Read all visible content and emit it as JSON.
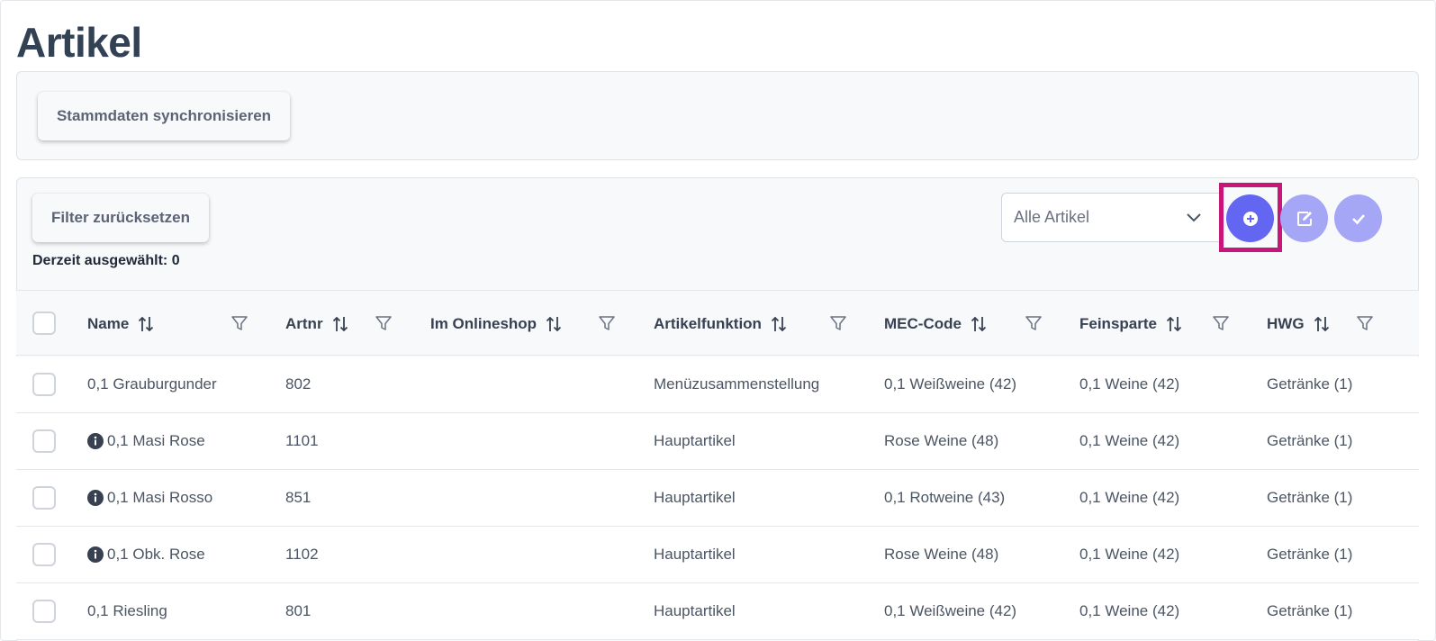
{
  "page": {
    "title": "Artikel"
  },
  "toolbar": {
    "sync_label": "Stammdaten synchronisieren"
  },
  "table_panel": {
    "reset_filter_label": "Filter zurücksetzen",
    "selected_text": "Derzeit ausgewählt: 0",
    "select_value": "Alle Artikel"
  },
  "actions": {
    "add_icon": "plus-circle-icon",
    "edit_icon": "edit-icon",
    "confirm_icon": "check-icon"
  },
  "colors": {
    "primary": "#6366f1",
    "primary_light": "#a5a6f6",
    "highlight": "#c8157a"
  },
  "columns": [
    "Name",
    "Artnr",
    "Im Onlineshop",
    "Artikelfunktion",
    "MEC-Code",
    "Feinsparte",
    "HWG"
  ],
  "rows": [
    {
      "name": "0,1 Grauburgunder",
      "info": false,
      "artnr": "802",
      "onlineshop": "",
      "funktion": "Menüzusammenstellung",
      "mec": "0,1 Weißweine (42)",
      "feinsparte": "0,1 Weine (42)",
      "hwg": "Getränke (1)"
    },
    {
      "name": "0,1 Masi Rose",
      "info": true,
      "artnr": "1101",
      "onlineshop": "",
      "funktion": "Hauptartikel",
      "mec": "Rose Weine (48)",
      "feinsparte": "0,1 Weine (42)",
      "hwg": "Getränke (1)"
    },
    {
      "name": "0,1 Masi Rosso",
      "info": true,
      "artnr": "851",
      "onlineshop": "",
      "funktion": "Hauptartikel",
      "mec": "0,1 Rotweine (43)",
      "feinsparte": "0,1 Weine (42)",
      "hwg": "Getränke (1)"
    },
    {
      "name": "0,1 Obk. Rose",
      "info": true,
      "artnr": "1102",
      "onlineshop": "",
      "funktion": "Hauptartikel",
      "mec": "Rose Weine (48)",
      "feinsparte": "0,1 Weine (42)",
      "hwg": "Getränke (1)"
    },
    {
      "name": "0,1 Riesling",
      "info": false,
      "artnr": "801",
      "onlineshop": "",
      "funktion": "Hauptartikel",
      "mec": "0,1 Weißweine (42)",
      "feinsparte": "0,1 Weine (42)",
      "hwg": "Getränke (1)"
    }
  ]
}
